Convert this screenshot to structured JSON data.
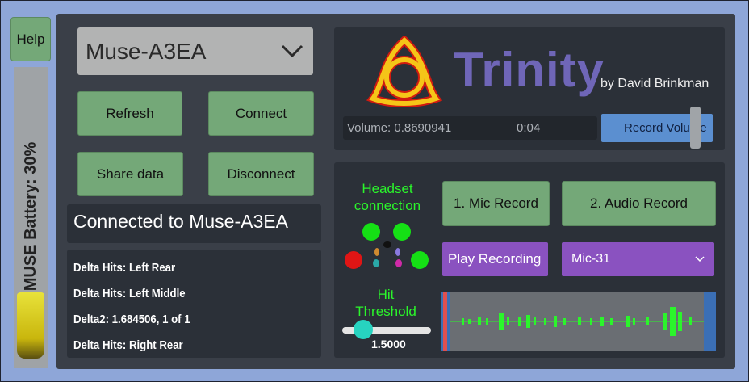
{
  "help_label": "Help",
  "battery": {
    "label": "MUSE Battery: 30%",
    "level": 0.3
  },
  "device_dropdown": {
    "selected": "Muse-A3EA"
  },
  "buttons": {
    "refresh": "Refresh",
    "connect": "Connect",
    "share_data": "Share data",
    "disconnect": "Disconnect"
  },
  "status_text": "Connected to Muse-A3EA",
  "log_lines": [
    "Delta Hits: Left Rear",
    "Delta Hits: Left Middle",
    "Delta2: 1.684506, 1 of 1",
    "Delta Hits: Right Rear"
  ],
  "header": {
    "title": "Trinity",
    "byline": "by David Brinkman",
    "volume_text": "Volume: 0.8690941",
    "time_text": "0:04",
    "record_volume_label": "Record Volume"
  },
  "headset": {
    "label": "Headset connection",
    "sensor_colors": [
      "#15e015",
      "#15e015",
      "#e01515",
      "#15e015"
    ]
  },
  "recording": {
    "mic_record": "1. Mic Record",
    "audio_record": "2. Audio Record",
    "play_recording": "Play Recording",
    "mic_select": "Mic-31"
  },
  "threshold": {
    "label": "Hit Threshold",
    "value": "1.5000"
  },
  "colors": {
    "accent_green": "#74a878",
    "purple": "#8a52c0",
    "title_purple": "#6f66b8",
    "signal_green": "#2bf52b"
  }
}
